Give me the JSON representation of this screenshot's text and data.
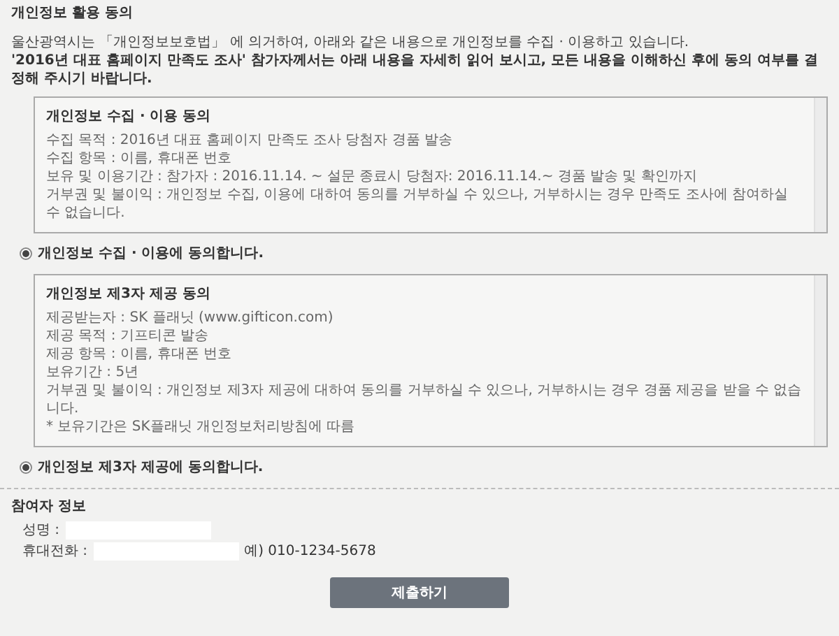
{
  "page_title": "개인정보 활용 동의",
  "intro": [
    "울산광역시는 「개인정보보호법」 에 의거하여, 아래와 같은 내용으로 개인정보를 수집 · 이용하고 있습니다.",
    "'2016년 대표 홈페이지 만족도 조사' 참가자께서는 아래 내용을 자세히 읽어 보시고, 모든 내용을 이해하신 후에 동의 여부를 결정해 주시기 바랍니다."
  ],
  "consents": [
    {
      "title": "개인정보 수집 · 이용 동의",
      "lines": [
        "수집 목적 : 2016년 대표 홈페이지 만족도 조사 당첨자 경품 발송",
        "수집 항목 : 이름, 휴대폰 번호",
        "보유 및 이용기간 : 참가자 : 2016.11.14. ~ 설문 종료시    당첨자: 2016.11.14.~ 경품 발송 및 확인까지",
        "거부권 및 불이익 : 개인정보 수집, 이용에 대하여 동의를 거부하실 수 있으나, 거부하시는 경우 만족도 조사에 참여하실 수 없습니다."
      ],
      "agree_label": "개인정보 수집 · 이용에 동의합니다.",
      "selected": true
    },
    {
      "title": "개인정보 제3자 제공 동의",
      "lines": [
        "제공받는자 : SK 플래닛 (www.gifticon.com)",
        "제공 목적 : 기프티콘 발송",
        "제공 항목 : 이름, 휴대폰 번호",
        "보유기간 : 5년",
        "거부권 및 불이익 : 개인정보 제3자 제공에 대하여 동의를 거부하실 수 있으나, 거부하시는 경우 경품 제공을 받을 수 없습니다.",
        "* 보유기간은 SK플래닛 개인정보처리방침에 따름"
      ],
      "agree_label": "개인정보 제3자 제공에 동의합니다.",
      "selected": true
    }
  ],
  "participant": {
    "title": "참여자 정보",
    "fields": [
      {
        "label": "성명 :"
      },
      {
        "label": "휴대전화 :",
        "hint": "예) 010-1234-5678"
      }
    ]
  },
  "submit": "제출하기"
}
